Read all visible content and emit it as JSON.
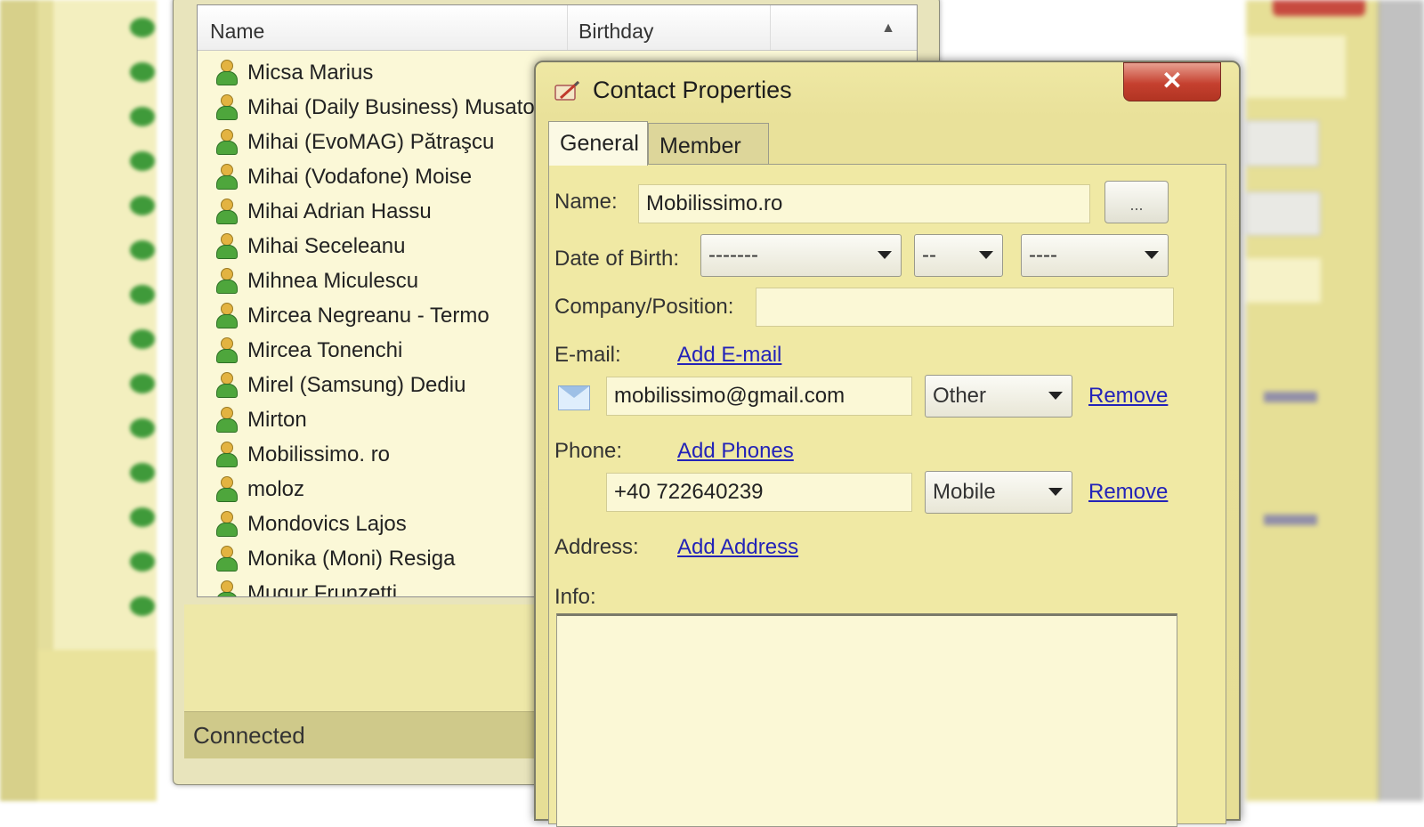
{
  "list_window": {
    "columns": {
      "name": "Name",
      "birthday": "Birthday"
    },
    "contacts": [
      "Micsa Marius",
      "Mihai (Daily Business) Musato",
      "Mihai (EvoMAG) Pătraşcu",
      "Mihai (Vodafone) Moise",
      "Mihai Adrian Hassu",
      "Mihai Seceleanu",
      "Mihnea Miculescu",
      "Mircea Negreanu - Termo",
      "Mircea Tonenchi",
      "Mirel (Samsung) Dediu",
      "Mirton",
      "Mobilissimo. ro",
      "moloz",
      "Mondovics Lajos",
      "Monika (Moni) Resiga",
      "Mugur Frunzetti"
    ],
    "status": "Connected"
  },
  "dialog": {
    "title": "Contact Properties",
    "close_glyph": "✕",
    "tabs": [
      "General",
      "Member Of"
    ],
    "name_label": "Name:",
    "name_value": "Mobilissimo.ro",
    "name_button": "...",
    "dob_label": "Date of Birth:",
    "dob_day": "-------",
    "dob_month": "--",
    "dob_year": "----",
    "company_label": "Company/Position:",
    "company_value": "",
    "email_label": "E-mail:",
    "add_email": "Add E-mail",
    "email_value": "mobilissimo@gmail.com",
    "email_type": "Other",
    "email_remove": "Remove",
    "phone_label": "Phone:",
    "add_phones": "Add Phones",
    "phone_value": "+40 722640239",
    "phone_type": "Mobile",
    "phone_remove": "Remove",
    "address_label": "Address:",
    "add_address": "Add Address",
    "info_label": "Info:",
    "info_value": ""
  }
}
